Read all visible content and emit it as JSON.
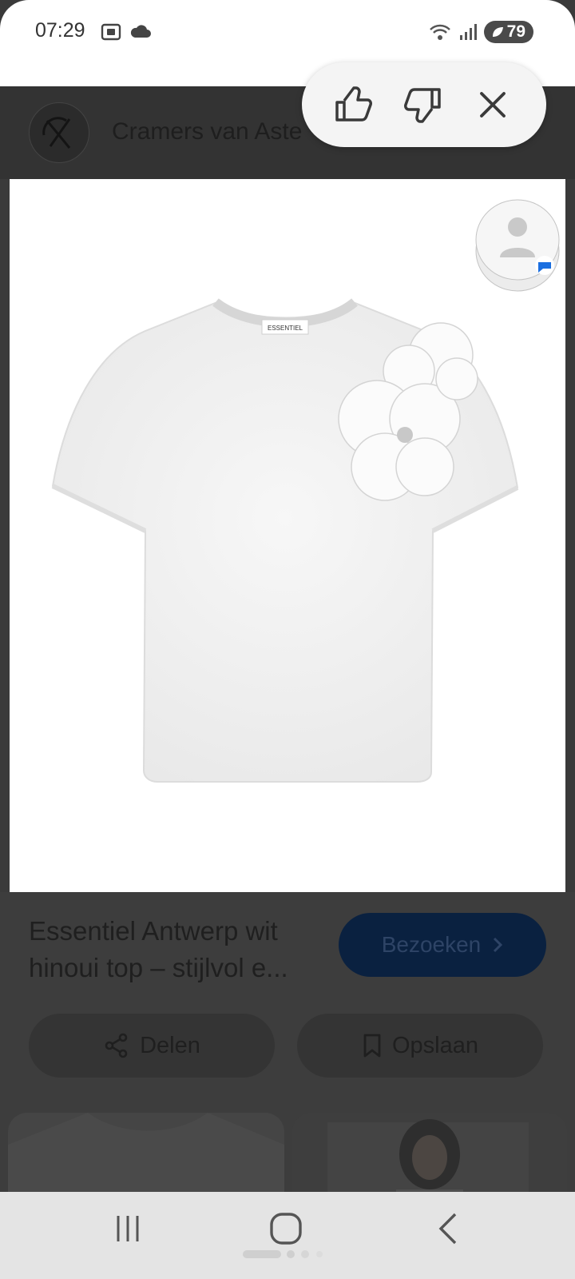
{
  "status_bar": {
    "time": "07:29",
    "battery": "79",
    "icons_left": [
      "screenshot-icon",
      "cloud-icon"
    ],
    "icons_right": [
      "wifi-icon",
      "signal-icon",
      "battery-icon"
    ]
  },
  "header": {
    "site_title": "Cramers van Aste",
    "logo_icon": "cva-logo"
  },
  "feedback": {
    "icons": [
      "thumbs-up-icon",
      "thumbs-down-icon",
      "close-icon"
    ]
  },
  "product": {
    "title": "Essentiel Antwerp wit hinoui top – stijlvol e...",
    "visit_label": "Bezoeken",
    "share_label": "Delen",
    "save_label": "Opslaan",
    "garment_brand_label": "ESSENTIEL"
  },
  "colors": {
    "header_bg": "#333333",
    "visit_button_bg": "#0a2140",
    "overlay_dark": "#3d3d3d"
  }
}
